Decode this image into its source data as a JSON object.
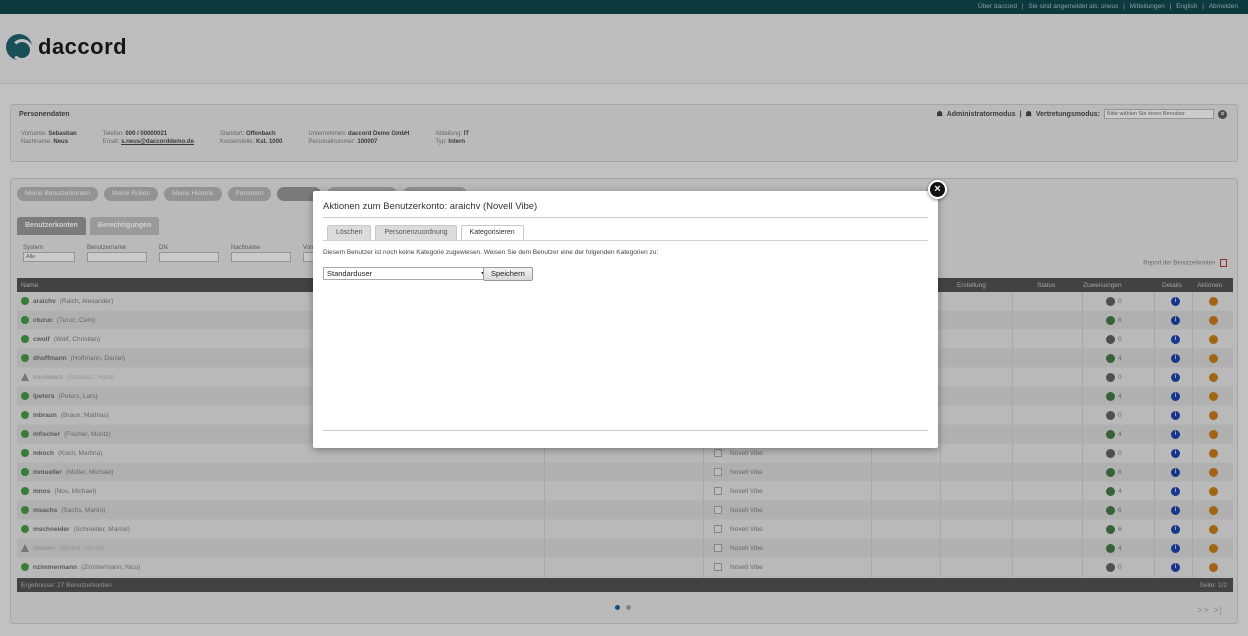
{
  "topbar": {
    "links": [
      "Über daccord",
      "|",
      "Sie sind angemeldet als: sneus",
      "|",
      "Mitteilungen",
      "|",
      "English",
      "|",
      "Abmelden"
    ]
  },
  "logo": {
    "text": "daccord"
  },
  "person": {
    "title": "Personendaten",
    "admin_mode": "Administratormodus",
    "sep": "|",
    "deputy_mode": "Vertretungsmodus:",
    "deputy_placeholder": "Bitte wählen Sie einen Benutzer",
    "fields": [
      {
        "l1": "Vorname:",
        "v1": "Sebastian",
        "l2": "Nachname:",
        "v2": "Neus"
      },
      {
        "l1": "Telefon:",
        "v1": "000 / 00000021",
        "l2": "Email:",
        "v2": "s.neus@daccorddemo.de"
      },
      {
        "l1": "Standort:",
        "v1": "Offenbach",
        "l2": "Kostenstelle:",
        "v2": "Kst. 1000"
      },
      {
        "l1": "Unternehmen:",
        "v1": "daccord Demo GmbH",
        "l2": "Personalnummer:",
        "v2": "100007"
      },
      {
        "l1": "Abteilung:",
        "v1": "IT",
        "l2": "Typ:",
        "v2": "Intern"
      }
    ]
  },
  "nav": {
    "pills": [
      "Meine Benutzerkonten",
      "Meine Rollen",
      "Meine Historie",
      "Personen",
      "",
      "",
      ""
    ]
  },
  "subtabs": [
    "Benutzerkonten",
    "Berechtigungen"
  ],
  "filters": {
    "system_label": "System",
    "system_value": "Alle",
    "username_label": "Benutzername",
    "dn_label": "DN",
    "lastname_label": "Nachname",
    "firstname_label": "Vorname"
  },
  "report_label": "Report der Benutzerkonten",
  "table": {
    "headers": {
      "name": "Name",
      "erstellung": "Erstellung",
      "status": "Status",
      "zuweisungen": "Zuweisungen",
      "details": "Details",
      "aktionen": "Aktionen"
    },
    "rows": [
      {
        "user": "araichv",
        "full": "(Raich, Alexander)",
        "system": "",
        "zuw": "0",
        "state": "ok",
        "zcolor": "grey"
      },
      {
        "user": "cturuc",
        "full": "(Turuc, Cem)",
        "system": "",
        "zuw": "6",
        "state": "ok",
        "zcolor": "green"
      },
      {
        "user": "cwolf",
        "full": "(Wolf, Christian)",
        "system": "",
        "zuw": "0",
        "state": "ok",
        "zcolor": "grey"
      },
      {
        "user": "dhoffmann",
        "full": "(Hoffmann, Daniel)",
        "system": "",
        "zuw": "4",
        "state": "ok",
        "zcolor": "green"
      },
      {
        "user": "hschwarz",
        "full": "(Schwarz, Hans)",
        "system": "",
        "zuw": "0",
        "state": "warn",
        "zcolor": "grey"
      },
      {
        "user": "lpeters",
        "full": "(Peters, Lars)",
        "system": "",
        "zuw": "4",
        "state": "ok",
        "zcolor": "green"
      },
      {
        "user": "mbraun",
        "full": "(Braun, Mathias)",
        "system": "",
        "zuw": "0",
        "state": "ok",
        "zcolor": "grey"
      },
      {
        "user": "mfischer",
        "full": "(Fischer, Moritz)",
        "system": "",
        "zuw": "4",
        "state": "ok",
        "zcolor": "green"
      },
      {
        "user": "mkoch",
        "full": "(Koch, Martina)",
        "system": "Novell Vibe",
        "zuw": "0",
        "state": "ok",
        "zcolor": "grey"
      },
      {
        "user": "mmueller",
        "full": "(Müller, Michael)",
        "system": "Novell Vibe",
        "zuw": "6",
        "state": "ok",
        "zcolor": "green"
      },
      {
        "user": "mnos",
        "full": "(Nos, Michael)",
        "system": "Novell Vibe",
        "zuw": "4",
        "state": "ok",
        "zcolor": "green"
      },
      {
        "user": "msachs",
        "full": "(Sachs, Martin)",
        "system": "Novell Vibe",
        "zuw": "6",
        "state": "ok",
        "zcolor": "green"
      },
      {
        "user": "mschneider",
        "full": "(Schneider, Marcel)",
        "system": "Novell Vibe",
        "zuw": "6",
        "state": "ok",
        "zcolor": "green"
      },
      {
        "user": "nweber",
        "full": "(Weber, Nicole)",
        "system": "Novell Vibe",
        "zuw": "4",
        "state": "warn",
        "zcolor": "green"
      },
      {
        "user": "nzimmermann",
        "full": "(Zimmermann, Nico)",
        "system": "Novell Vibe",
        "zuw": "0",
        "state": "ok",
        "zcolor": "grey"
      }
    ],
    "footer_left": "Ergebnisse: 27 Benutzerkonten",
    "footer_right": "Seite: 1/2"
  },
  "pager": {
    "next": ">> >|"
  },
  "modal": {
    "title": "Aktionen zum Benutzerkonto: araichv (Novell Vibe)",
    "tabs": [
      "Löschen",
      "Personenzuordnung",
      "Kategorisieren"
    ],
    "active_tab": 2,
    "info": "Diesem Benutzer ist noch keine Kategorie zugewiesen. Weisen Sie dem Benutzer eine der folgenden Kategorien zu:",
    "select_value": "Standarduser",
    "save_label": "Speichern",
    "close_glyph": "×"
  },
  "colors": {
    "topbar": "#0f4248",
    "accent": "#1d5a63",
    "ok": "#3f8f3f",
    "details": "#1b3e9c",
    "actions": "#b8741a"
  }
}
